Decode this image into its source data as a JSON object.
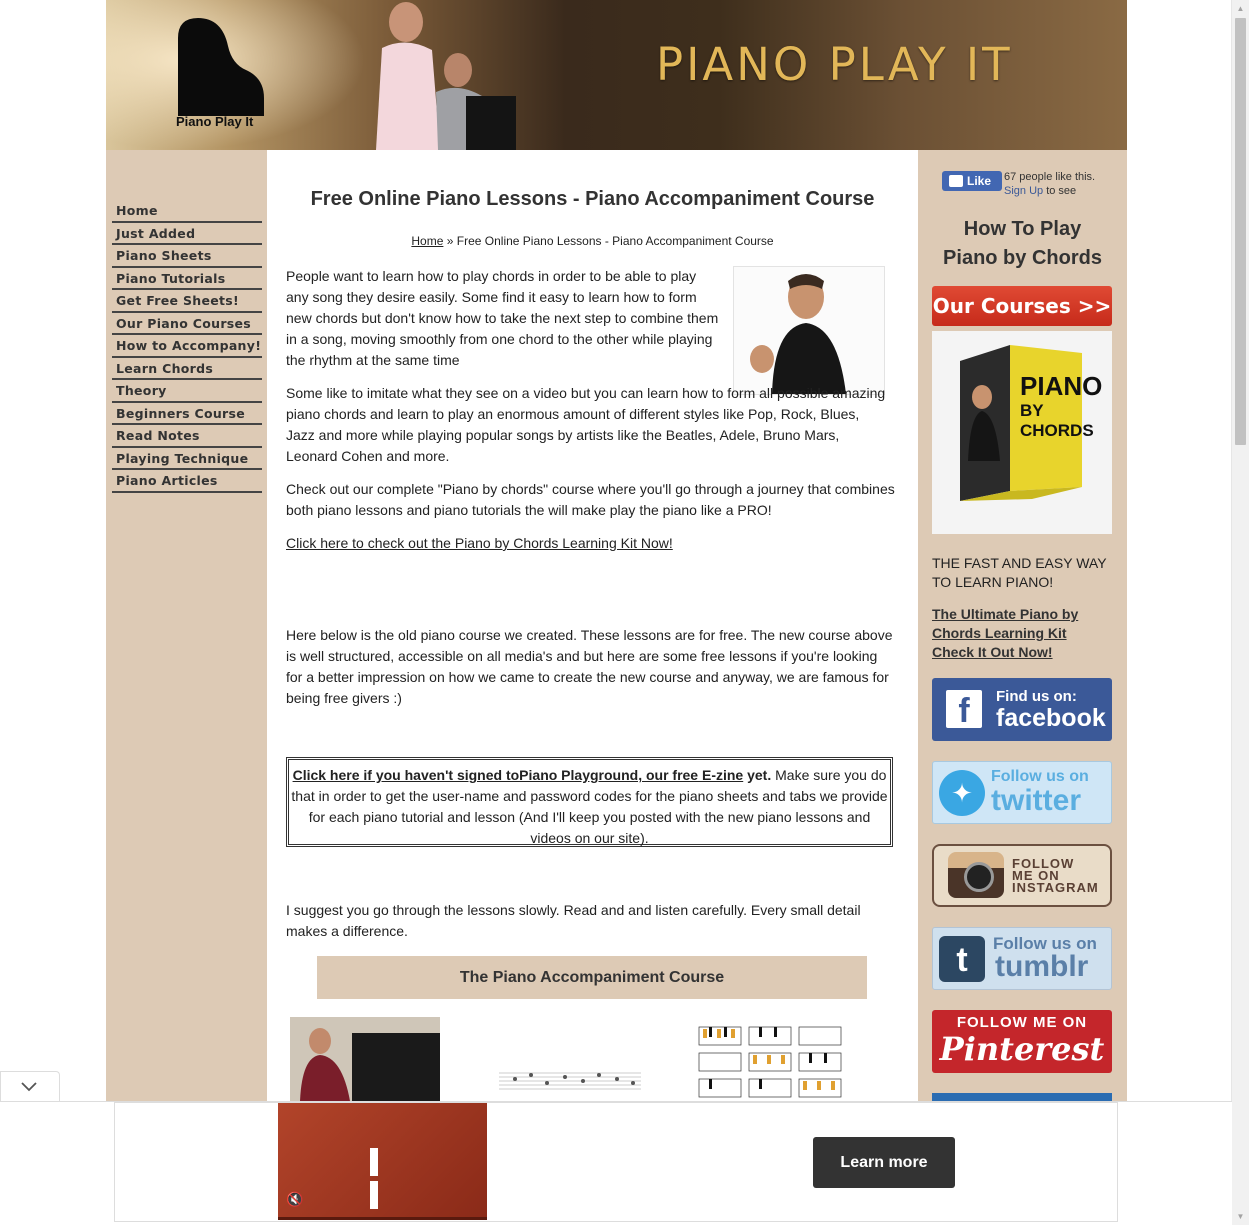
{
  "header": {
    "logo_text": "Piano Play It",
    "site_title": "PIANO PLAY IT"
  },
  "nav": {
    "items": [
      {
        "label": "Home"
      },
      {
        "label": "Just Added"
      },
      {
        "label": "Piano Sheets"
      },
      {
        "label": "Piano Tutorials"
      },
      {
        "label": "Get Free Sheets!"
      },
      {
        "label": "Our Piano Courses"
      },
      {
        "label": "How to Accompany!"
      },
      {
        "label": "Learn Chords"
      },
      {
        "label": "Theory"
      },
      {
        "label": "Beginners Course"
      },
      {
        "label": "Read Notes"
      },
      {
        "label": "Playing Technique"
      },
      {
        "label": "Piano Articles"
      }
    ]
  },
  "main": {
    "title": "Free Online Piano Lessons - Piano Accompaniment Course",
    "breadcrumb": {
      "home": "Home",
      "separator": "»",
      "current": "Free Online Piano Lessons - Piano Accompaniment Course"
    },
    "paragraphs": {
      "p1": "People want to learn how to play chords in order to be able to play any song they desire easily. Some find it easy to learn how to form new chords but don't know how to take the next step to combine them in a song, moving smoothly from one chord to the other while playing the rhythm at the same time",
      "p2": "Some like to imitate what they see on a video but you can learn how to form all possible amazing piano chords and learn to play an enormous amount of different styles like Pop, Rock, Blues, Jazz and more while playing popular songs by artists like the Beatles, Adele, Bruno Mars, Leonard Cohen and more.",
      "p3": "Check out our complete \"Piano by chords\" course where you'll go through a journey that combines both piano lessons and piano tutorials the will make play the piano like a PRO!",
      "p4": "Here below is the old piano course we created. These lessons are for free. The new course above is well structured, accessible on all media's and but here are some free lessons if you're looking for a better impression on how we came to create the new course and anyway, we are famous for being free givers :)",
      "p5": "I suggest you go through the lessons slowly. Read and and listen carefully. Every small detail makes a difference."
    },
    "kit_link": "Click here to check out the Piano by Chords Learning Kit Now",
    "kit_link_suffix": "!",
    "signup": {
      "link": "Click here if you haven't signed toPiano Playground, our free E-zine",
      "bold_suffix": " yet.",
      "text": " Make sure you do that in order to get the user-name and password codes for the piano sheets and tabs we provide for each piano tutorial and lesson (And I'll keep you posted with the new piano lessons and videos on our site)."
    },
    "course_banner": "The Piano Accompaniment Course"
  },
  "sidebar": {
    "fb_like_label": "Like",
    "fb_count_text": "67 people like this.",
    "fb_signup_link": "Sign Up",
    "fb_signup_suffix": " to see",
    "heading": "How To Play Piano by Chords",
    "courses_button": "Our Courses >>",
    "product_title_1": "PIANO",
    "product_title_2": "BY CHORDS",
    "fast_text": "THE FAST AND EASY WAY TO LEARN PIANO!",
    "ultimate_link": "The Ultimate Piano by Chords Learning Kit Check It Out Now!",
    "social": {
      "facebook_1": "Find us on:",
      "facebook_2": "facebook",
      "twitter_1": "Follow us on",
      "twitter_2": "twitter",
      "instagram_1": "FOLLOW",
      "instagram_2": "ME ON",
      "instagram_3": "INSTAGRAM",
      "tumblr_1": "Follow us on",
      "tumblr_2": "tumblr",
      "pinterest_1": "FOLLOW ME ON",
      "pinterest_2": "Pinterest"
    }
  },
  "ad": {
    "learn_more": "Learn more"
  },
  "colors": {
    "tan": "#ddcab5",
    "title_gold": "#e2b758",
    "course_red": "#c62a1a",
    "facebook_blue": "#3b5998",
    "pinterest_red": "#c4262b"
  }
}
